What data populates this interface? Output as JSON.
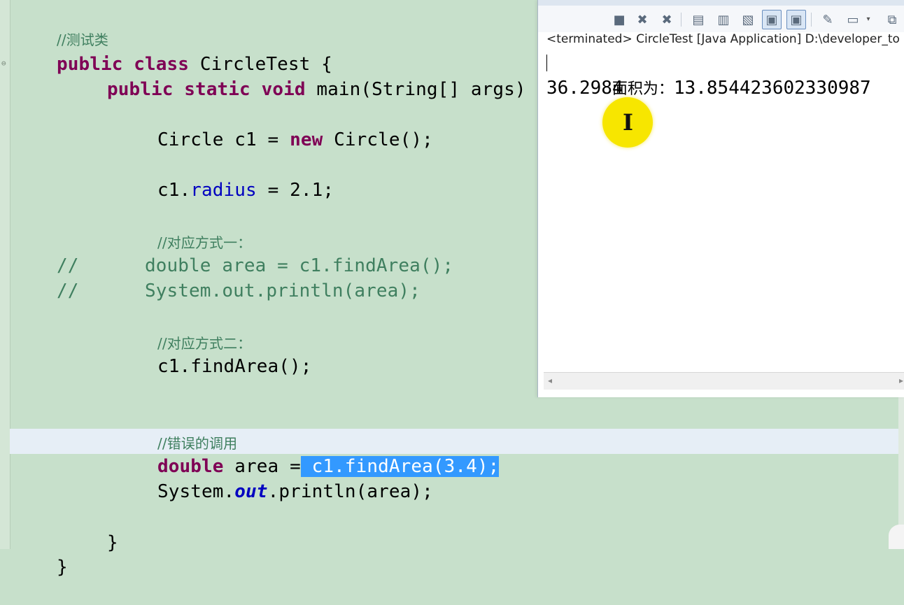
{
  "editor": {
    "lines": {
      "l0": {
        "text": "//测试类"
      },
      "l1": {
        "kw": "public class ",
        "rest": "CircleTest {"
      },
      "l2": {
        "kw1": "public static ",
        "type": "void ",
        "rest": "main(String[] args)"
      },
      "l4": {
        "pre": "Circle c1 = ",
        "kw": "new",
        "rest": " Circle();"
      },
      "l6": {
        "pre": "c1.",
        "fld": "radius",
        "rest": " = 2.1;"
      },
      "l8": {
        "text": "//对应方式一："
      },
      "l9": {
        "text": "//      double area = c1.findArea();"
      },
      "l10": {
        "text": "//      System.out.println(area);"
      },
      "l12": {
        "text": "//对应方式二："
      },
      "l13": {
        "text": "c1.findArea();"
      },
      "l16": {
        "text": "//错误的调用"
      },
      "l17": {
        "kw": "double",
        "mid": " area =",
        "sel": " c1.findArea(3.4);"
      },
      "l18": {
        "pre": "System.",
        "fld": "out",
        "rest": ".println(area);"
      },
      "l20": {
        "text": "}"
      },
      "l21": {
        "text": "}"
      }
    }
  },
  "console": {
    "status": "<terminated> CircleTest [Java Application] D:\\developer_to",
    "output": {
      "line1_label": "面积为：",
      "line1_value": "13.854423602330987",
      "line2": "36.2984"
    },
    "toolbar": {
      "terminate": "■",
      "remove_launch": "✖",
      "remove_all": "✖",
      "clear": "▤",
      "scroll_lock": "▥",
      "word_wrap": "▧",
      "show_stdout": "▣",
      "show_stderr": "▣",
      "pin": "✎",
      "display_console": "▭",
      "dropdown": "▾",
      "new_console": "⧉"
    }
  },
  "colors": {
    "editor_bg": "#c7e0cb",
    "keyword": "#7f0055",
    "comment": "#3f7f5f",
    "field": "#0000c0",
    "selection": "#3399ff",
    "cursor_highlight": "#f7e600"
  }
}
